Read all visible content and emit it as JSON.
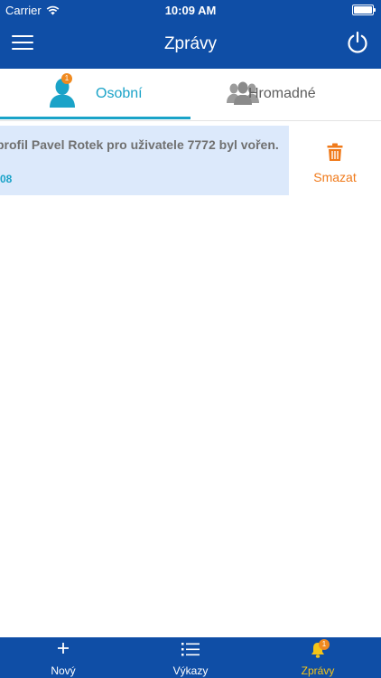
{
  "status_bar": {
    "carrier": "Carrier",
    "time": "10:09 AM"
  },
  "header": {
    "title": "Zprávy"
  },
  "tabs": [
    {
      "label": "Osobní",
      "badge": "1",
      "selected": true
    },
    {
      "label": "Hromadné",
      "selected": false
    }
  ],
  "messages": [
    {
      "text": "profil Pavel Rotek pro uživatele 7772 byl vořen.",
      "time": ":08",
      "delete_label": "Smazat"
    }
  ],
  "bottom_nav": [
    {
      "label": "Nový",
      "icon": "plus-icon"
    },
    {
      "label": "Výkazy",
      "icon": "list-icon"
    },
    {
      "label": "Zprávy",
      "icon": "bell-icon",
      "badge": "1",
      "active": true
    }
  ],
  "colors": {
    "primary": "#0f4ea6",
    "accent": "#1aa3c8",
    "highlight": "#dce9fb",
    "delete": "#f07a1a",
    "active_nav": "#f5c518",
    "badge": "#f08a1f"
  }
}
